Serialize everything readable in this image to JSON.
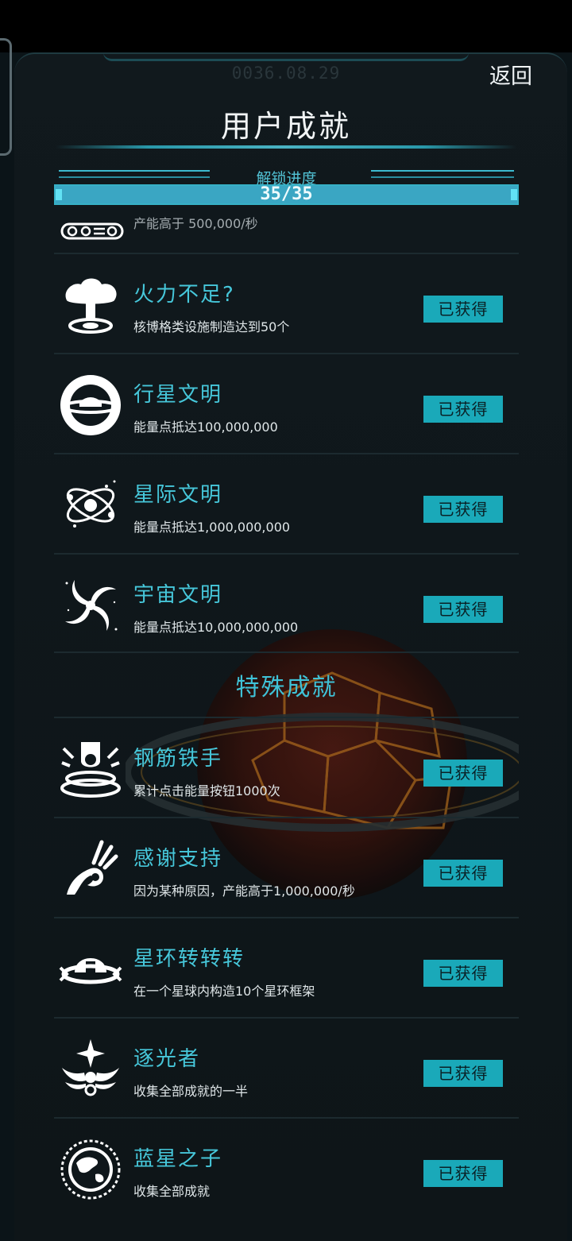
{
  "header": {
    "date": "0036.08.29",
    "back_label": "返回",
    "title": "用户成就"
  },
  "progress": {
    "label": "解锁进度",
    "text": "35/35",
    "fraction": 1.0
  },
  "partial_item": {
    "desc": "产能高于 500,000/秒"
  },
  "achievements_a": [
    {
      "icon": "mushroom-cloud-icon",
      "name": "火力不足?",
      "desc": "核博格类设施制造达到50个",
      "status": "已获得"
    },
    {
      "icon": "planet-icon",
      "name": "行星文明",
      "desc": "能量点抵达100,000,000",
      "status": "已获得"
    },
    {
      "icon": "atom-orbit-icon",
      "name": "星际文明",
      "desc": "能量点抵达1,000,000,000",
      "status": "已获得"
    },
    {
      "icon": "spiral-galaxy-icon",
      "name": "宇宙文明",
      "desc": "能量点抵达10,000,000,000",
      "status": "已获得"
    }
  ],
  "special_section": {
    "title": "特殊成就"
  },
  "achievements_b": [
    {
      "icon": "pressing-button-icon",
      "name": "钢筋铁手",
      "desc": "累计点击能量按钮1000次",
      "status": "已获得"
    },
    {
      "icon": "ok-hand-icon",
      "name": "感谢支持",
      "desc": "因为某种原因，产能高于1,000,000/秒",
      "status": "已获得"
    },
    {
      "icon": "ring-frame-icon",
      "name": "星环转转转",
      "desc": "在一个星球内构造10个星环框架",
      "status": "已获得"
    },
    {
      "icon": "winged-star-icon",
      "name": "逐光者",
      "desc": "收集全部成就的一半",
      "status": "已获得"
    },
    {
      "icon": "earth-emblem-icon",
      "name": "蓝星之子",
      "desc": "收集全部成就",
      "status": "已获得"
    }
  ],
  "colors": {
    "accent": "#46c7da",
    "badge": "#1aa9b9",
    "background": "#0b1418"
  }
}
